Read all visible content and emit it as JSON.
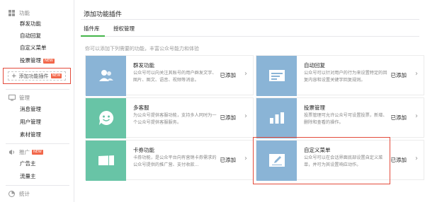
{
  "sidebar": {
    "groups": [
      {
        "icon": "grid-icon",
        "title": "功能",
        "items": [
          {
            "label": "群发功能"
          },
          {
            "label": "自动回复"
          },
          {
            "label": "自定义菜单"
          },
          {
            "label": "投票管理",
            "badge": "NEW"
          }
        ]
      },
      {
        "icon": "monitor-icon",
        "title": "管理",
        "items": [
          {
            "label": "消息管理"
          },
          {
            "label": "用户管理"
          },
          {
            "label": "素材管理"
          }
        ]
      },
      {
        "icon": "megaphone-icon",
        "title": "推广",
        "badge": "NEW",
        "items": [
          {
            "label": "广告主"
          },
          {
            "label": "流量主"
          }
        ]
      },
      {
        "icon": "stats-icon",
        "title": "统计",
        "items": []
      }
    ],
    "add_plugin": {
      "label": "添加功能插件",
      "badge": "NEW"
    }
  },
  "main": {
    "title": "添加功能插件",
    "tabs": [
      {
        "label": "插件库",
        "active": true
      },
      {
        "label": "授权管理",
        "active": false
      }
    ],
    "hint": "你可以添加下列需要的功能，丰富公众号能力和体验",
    "plugins": [
      {
        "name": "群发功能",
        "desc": "公众号可以向关注其账号的用户群发文字、图片、图文、语音、视频等消息。",
        "status": "已添加",
        "icon": "users-icon",
        "color": "#8ab4d6"
      },
      {
        "name": "自动回复",
        "desc": "公众号可以针对用户的行为来设置特定的回复内容和设置关键字回复规则。",
        "status": "已添加",
        "icon": "reply-card-icon",
        "color": "#8ab4d6"
      },
      {
        "name": "多客服",
        "desc": "为公众号提供客服功能，支持多人同时为一个公众号提供客服服务。",
        "status": "已添加",
        "icon": "smiley-icon",
        "color": "#68c4a6"
      },
      {
        "name": "投票管理",
        "desc": "投票管理可允许公众号可设置投票，新增、删除和查看的操作。",
        "status": "已添加",
        "icon": "bar-chart-icon",
        "color": "#8ab4d6"
      },
      {
        "name": "卡券功能",
        "desc": "卡券功能，是公众平台向有营销卡券需求的公众号提供的推广营、支付收款...",
        "status": "已添加",
        "icon": "ticket-icon",
        "color": "#68c4a6"
      },
      {
        "name": "自定义菜单",
        "desc": "公众号可以在会话界面底部设置自定义菜单，并可为其设置响应动作。",
        "status": "已添加",
        "icon": "edit-icon",
        "color": "#8ab4d6"
      }
    ]
  },
  "colors": {
    "accent_green": "#44b549",
    "highlight_red": "#e34b3c",
    "badge": "#f2674a"
  }
}
